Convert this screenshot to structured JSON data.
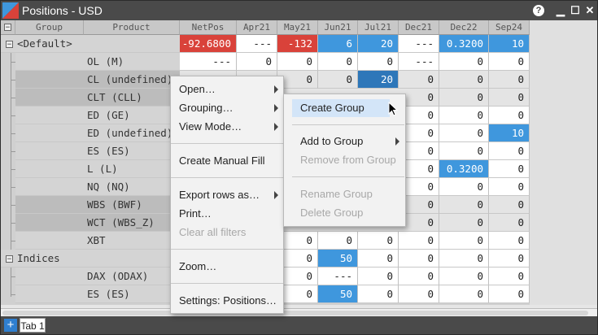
{
  "window": {
    "title": "Positions - USD"
  },
  "titlebar_buttons": {
    "help": "?",
    "minimize": "▁",
    "maximize": "☐",
    "close": "✕"
  },
  "columns": {
    "group": "Group",
    "product": "Product",
    "netpos": "NetPos",
    "apr21": "Apr21",
    "may21": "May21",
    "jun21": "Jun21",
    "jul21": "Jul21",
    "dec21": "Dec21",
    "dec22": "Dec22",
    "sep24": "Sep24"
  },
  "rows": [
    {
      "group": "<Default>",
      "product": "",
      "netpos": "-92.6800",
      "apr21": "---",
      "may21": "-132",
      "jun21": "6",
      "jul21": "20",
      "dec21": "---",
      "dec22": "0.3200",
      "sep24": "10"
    },
    {
      "product": "OL (M)",
      "netpos": "---",
      "apr21": "0",
      "may21": "0",
      "jun21": "0",
      "jul21": "0",
      "dec21": "---",
      "dec22": "0",
      "sep24": "0"
    },
    {
      "product": "CL (undefined)",
      "netpos": "",
      "apr21": "",
      "may21": "0",
      "jun21": "0",
      "jul21": "20",
      "dec21": "0",
      "dec22": "0",
      "sep24": "0"
    },
    {
      "product": "CLT (CLL)",
      "netpos": "",
      "apr21": "",
      "may21": "",
      "jun21": "",
      "jul21": "",
      "dec21": "0",
      "dec22": "0",
      "sep24": "0"
    },
    {
      "product": "ED (GE)",
      "netpos": "",
      "apr21": "",
      "may21": "",
      "jun21": "",
      "jul21": "",
      "dec21": "0",
      "dec22": "0",
      "sep24": "0"
    },
    {
      "product": "ED (undefined)",
      "netpos": "",
      "apr21": "",
      "may21": "",
      "jun21": "",
      "jul21": "",
      "dec21": "0",
      "dec22": "0",
      "sep24": "10"
    },
    {
      "product": "ES (ES)",
      "netpos": "",
      "apr21": "",
      "may21": "",
      "jun21": "",
      "jul21": "",
      "dec21": "0",
      "dec22": "0",
      "sep24": "0"
    },
    {
      "product": "L (L)",
      "netpos": "",
      "apr21": "",
      "may21": "",
      "jun21": "",
      "jul21": "",
      "dec21": "0",
      "dec22": "0.3200",
      "sep24": "0"
    },
    {
      "product": "NQ (NQ)",
      "netpos": "",
      "apr21": "",
      "may21": "",
      "jun21": "",
      "jul21": "",
      "dec21": "0",
      "dec22": "0",
      "sep24": "0"
    },
    {
      "product": "WBS (BWF)",
      "netpos": "",
      "apr21": "",
      "may21": "",
      "jun21": "",
      "jul21": "",
      "dec21": "0",
      "dec22": "0",
      "sep24": "0"
    },
    {
      "product": "WCT (WBS_Z)",
      "netpos": "",
      "apr21": "",
      "may21": "",
      "jun21": "",
      "jul21": "",
      "dec21": "0",
      "dec22": "0",
      "sep24": "0"
    },
    {
      "product": "XBT",
      "netpos": "",
      "apr21": "",
      "may21": "0",
      "jun21": "0",
      "jul21": "0",
      "dec21": "0",
      "dec22": "0",
      "sep24": "0"
    },
    {
      "group": "Indices",
      "product": "",
      "netpos": "",
      "apr21": "",
      "may21": "0",
      "jun21": "50",
      "jul21": "0",
      "dec21": "0",
      "dec22": "0",
      "sep24": "0"
    },
    {
      "product": "DAX (ODAX)",
      "netpos": "",
      "apr21": "",
      "may21": "0",
      "jun21": "---",
      "jul21": "0",
      "dec21": "0",
      "dec22": "0",
      "sep24": "0"
    },
    {
      "product": "ES (ES)",
      "netpos": "",
      "apr21": "",
      "may21": "0",
      "jun21": "50",
      "jul21": "0",
      "dec21": "0",
      "dec22": "0",
      "sep24": "0"
    }
  ],
  "context_menu": {
    "open": "Open…",
    "grouping": "Grouping…",
    "view_mode": "View Mode…",
    "create_manual_fill": "Create Manual Fill",
    "export_rows": "Export rows as…",
    "print": "Print…",
    "clear_filters": "Clear all filters",
    "zoom": "Zoom…",
    "settings": "Settings: Positions…"
  },
  "grouping_submenu": {
    "create_group": "Create Group",
    "add_to_group": "Add to Group",
    "remove_from_group": "Remove from Group",
    "rename_group": "Rename Group",
    "delete_group": "Delete Group"
  },
  "tabs": {
    "add": "+",
    "tab1": "Tab 1"
  },
  "colors": {
    "negative": "#d9423a",
    "positive": "#3f97dd",
    "selected": "#2e77b9",
    "titlebar": "#4a4a4a"
  }
}
